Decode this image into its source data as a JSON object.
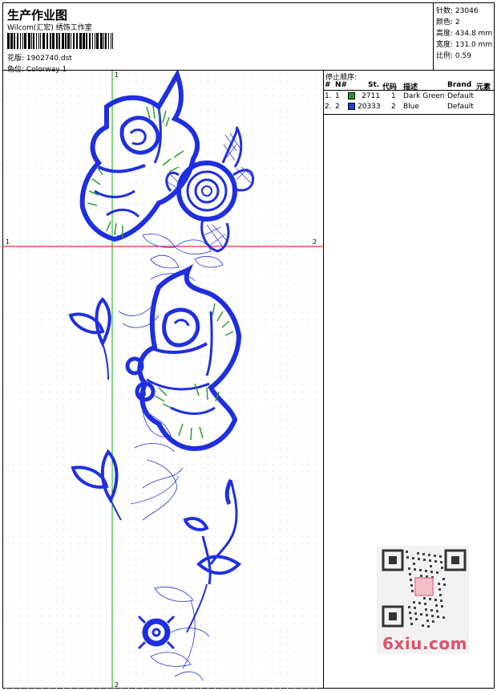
{
  "header": {
    "title": "生产作业图",
    "company": "Wilcom(汇宏) 绣饰工作室",
    "design_label": "花版:",
    "design_value": "1902740.dst",
    "colorway_label": "色位:",
    "colorway_value": "Colorway 1"
  },
  "stats": {
    "stitches_label": "针数:",
    "stitches_value": "23046",
    "colors_label": "颜色:",
    "colors_value": "2",
    "height_label": "高度:",
    "height_value": "434.8 mm",
    "width_label": "宽度:",
    "width_value": "131.0 mm",
    "scale_label": "比例:",
    "scale_value": "0.59"
  },
  "stop_sequence": {
    "title": "停止顺序:",
    "headers": {
      "num": "#",
      "needle": "N#",
      "stitches": "St.",
      "code": "代码",
      "desc": "描述",
      "brand": "Brand",
      "element": "元素"
    },
    "rows": [
      {
        "num": "1.",
        "needle": "1",
        "color": "#1c9b2a",
        "stitches": "2711",
        "code": "1",
        "desc": "Dark Green",
        "brand": "Default"
      },
      {
        "num": "2.",
        "needle": "2",
        "color": "#1f3fd8",
        "stitches": "20333",
        "code": "2",
        "desc": "Blue",
        "brand": "Default"
      }
    ]
  },
  "canvas": {
    "axis_labels": {
      "v_top": "1",
      "v_bottom": "2",
      "h_left": "1",
      "h_right": "2"
    },
    "colors": {
      "primary": "#1f2fe0",
      "green": "#2e9b2e",
      "h_axis": "#ff0000",
      "v_axis": "#00b000"
    }
  },
  "watermark": "6xiu.com"
}
